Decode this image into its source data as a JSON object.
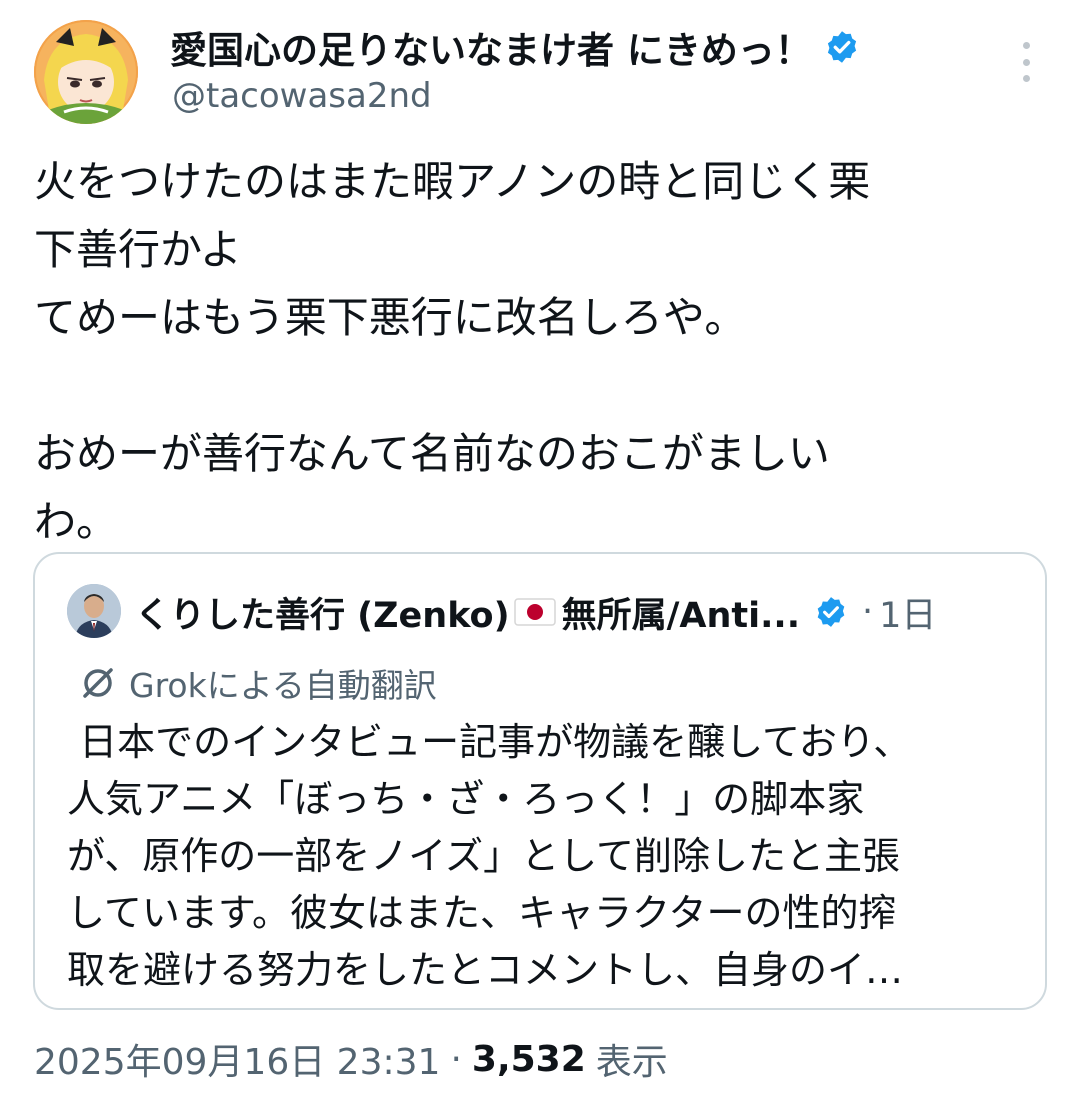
{
  "author": {
    "display_name": "愛国心の足りないなまけ者 にきめっ！",
    "handle": "@tacowasa2nd",
    "verified": true,
    "avatar": "anime-girl-avatar"
  },
  "tweet": {
    "text": "火をつけたのはまた暇アノンの時と同じく栗\n下善行かよ\nてめーはもう栗下悪行に改名しろや。\n\nおめーが善行なんて名前なのおこがましい\nわ。"
  },
  "quote": {
    "author_name": "くりした善行 (Zenko)",
    "author_name_suffix": "無所属/Anti...",
    "flag": "japan-flag-icon",
    "verified": true,
    "separator": "·",
    "time": "1日",
    "translation_label": "Grokによる自動翻訳",
    "text": " 日本でのインタビュー記事が物議を醸しており、\n人気アニメ「ぼっち・ざ・ろっく！」の脚本家\nが、原作の一部をノイズ」として削除したと主張\nしています。彼女はまた、キャラクターの性的搾\n取を避ける努力をしたとコメントし、自身のイ…"
  },
  "footer": {
    "timestamp": "2025年09月16日 23:31",
    "separator": "·",
    "views_count": "3,532",
    "views_label": "表示"
  },
  "colors": {
    "verified_blue": "#1d9bf0",
    "secondary_text": "#536471",
    "border": "#cfd9de"
  }
}
